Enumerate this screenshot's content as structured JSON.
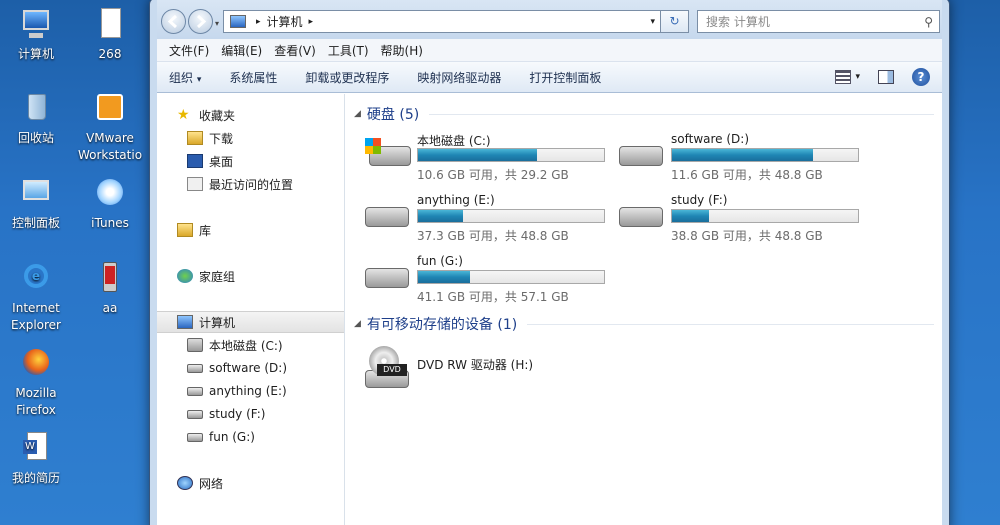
{
  "desktop": {
    "icons": [
      {
        "label": "计算机"
      },
      {
        "label": "268"
      },
      {
        "label": "回收站"
      },
      {
        "label": "VMware Workstatio"
      },
      {
        "label": "控制面板"
      },
      {
        "label": "iTunes"
      },
      {
        "label": "Internet Explorer"
      },
      {
        "label": "aa"
      },
      {
        "label": "Mozilla Firefox"
      },
      {
        "label": "我的简历"
      }
    ]
  },
  "address": {
    "crumb": "计算机",
    "search_placeholder": "搜索 计算机"
  },
  "menubar": [
    "文件(F)",
    "编辑(E)",
    "查看(V)",
    "工具(T)",
    "帮助(H)"
  ],
  "toolbar": {
    "organize": "组织",
    "sysprops": "系统属性",
    "uninstall": "卸载或更改程序",
    "mapdrive": "映射网络驱动器",
    "controlpanel": "打开控制面板"
  },
  "nav": {
    "favorites": "收藏夹",
    "downloads": "下载",
    "desktop": "桌面",
    "recent": "最近访问的位置",
    "libraries": "库",
    "homegroup": "家庭组",
    "computer": "计算机",
    "drive_c": "本地磁盘 (C:)",
    "drive_d": "software (D:)",
    "drive_e": "anything (E:)",
    "drive_f": "study (F:)",
    "drive_g": "fun (G:)",
    "network": "网络"
  },
  "content": {
    "hdd_group": "硬盘 (5)",
    "removable_group": "有可移动存储的设备 (1)",
    "drives": [
      {
        "name": "本地磁盘 (C:)",
        "free": "10.6 GB 可用，共 29.2 GB",
        "used_fraction": 0.64
      },
      {
        "name": "software (D:)",
        "free": "11.6 GB 可用，共 48.8 GB",
        "used_fraction": 0.76
      },
      {
        "name": "anything (E:)",
        "free": "37.3 GB 可用，共 48.8 GB",
        "used_fraction": 0.24
      },
      {
        "name": "study (F:)",
        "free": "38.8 GB 可用，共 48.8 GB",
        "used_fraction": 0.2
      },
      {
        "name": "fun (G:)",
        "free": "41.1 GB 可用，共 57.1 GB",
        "used_fraction": 0.28
      }
    ],
    "dvd": {
      "name": "DVD RW 驱动器 (H:)",
      "badge": "DVD"
    }
  },
  "colors": {
    "accent": "#1e3f8a",
    "bar_fill": "#1f86b4"
  }
}
